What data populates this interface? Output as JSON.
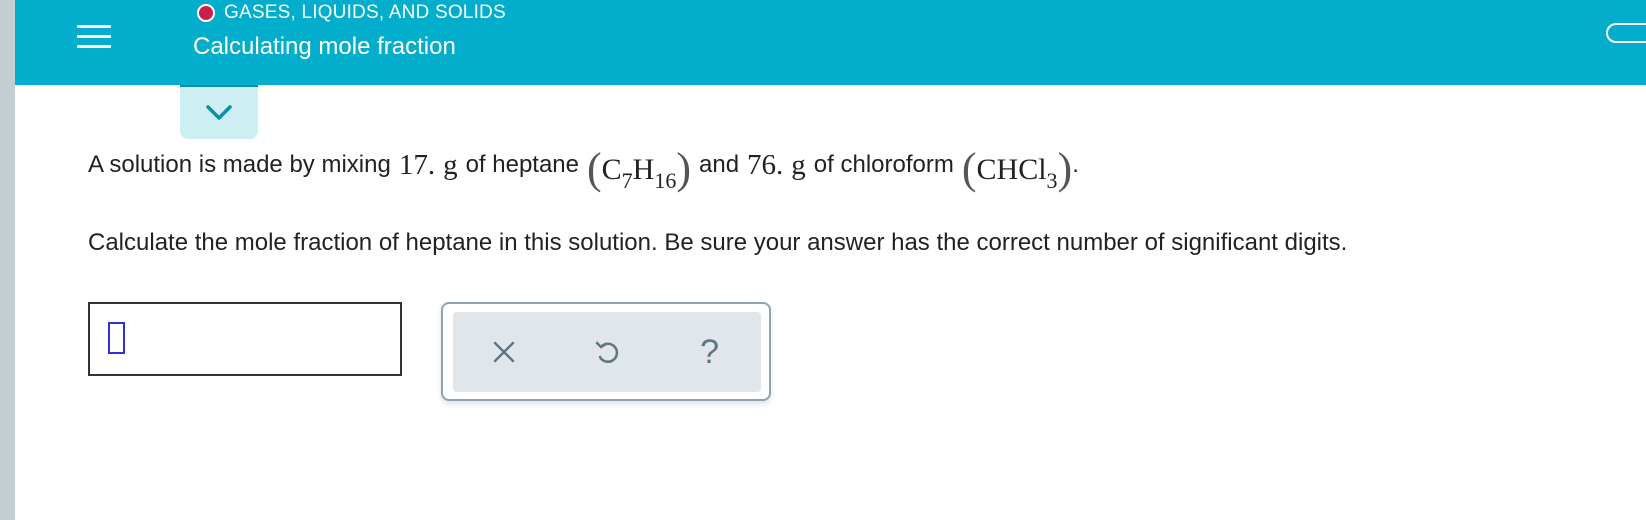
{
  "header": {
    "topic": "GASES, LIQUIDS, AND SOLIDS",
    "title": "Calculating mole fraction",
    "status_color": "#c8214c",
    "background_color": "#02aecb"
  },
  "problem": {
    "intro": "A solution is made by mixing",
    "mass1": "17.",
    "unit1": "g",
    "of1": "of heptane",
    "formula1": {
      "el1": "C",
      "n1": "7",
      "el2": "H",
      "n2": "16"
    },
    "and": "and",
    "mass2": "76.",
    "unit2": "g",
    "of2": "of chloroform",
    "formula2": {
      "el1": "CHCl",
      "n1": "3"
    },
    "period": "."
  },
  "question": "Calculate the mole fraction of heptane in this solution. Be sure your answer has the correct number of significant digits.",
  "answer": {
    "value": ""
  },
  "icons": {
    "menu": "hamburger-icon",
    "expand": "chevron-down-icon",
    "clear": "x-icon",
    "undo": "undo-icon",
    "help": "question-icon"
  },
  "tools": {
    "help_glyph": "?"
  }
}
